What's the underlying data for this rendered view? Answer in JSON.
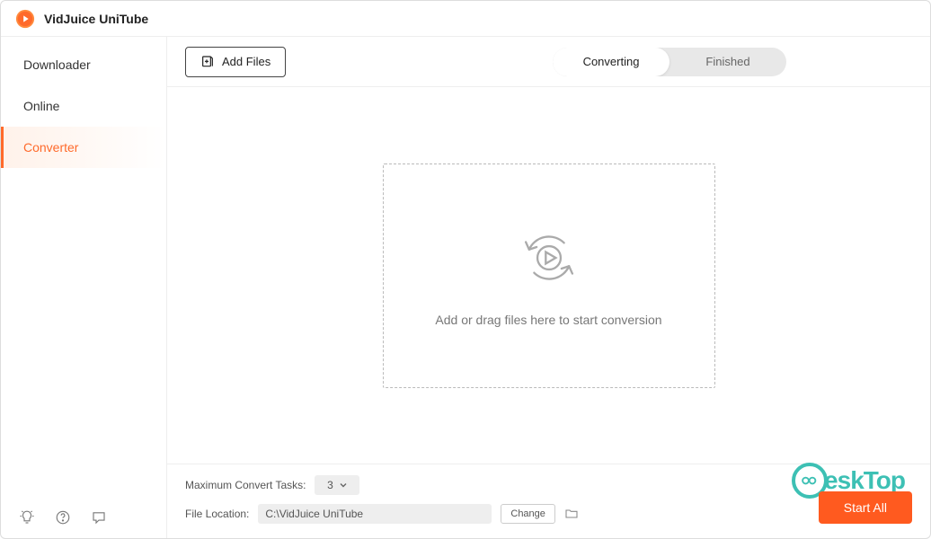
{
  "app": {
    "title": "VidJuice UniTube"
  },
  "sidebar": {
    "items": [
      {
        "label": "Downloader",
        "active": false
      },
      {
        "label": "Online",
        "active": false
      },
      {
        "label": "Converter",
        "active": true
      }
    ]
  },
  "toolbar": {
    "add_files_label": "Add Files",
    "tabs": [
      {
        "label": "Converting",
        "active": true
      },
      {
        "label": "Finished",
        "active": false
      }
    ]
  },
  "dropzone": {
    "hint": "Add or drag files here to start conversion"
  },
  "settings": {
    "max_tasks_label": "Maximum Convert Tasks:",
    "max_tasks_value": "3",
    "file_location_label": "File Location:",
    "file_location_value": "C:\\VidJuice UniTube",
    "change_label": "Change"
  },
  "actions": {
    "start_all_label": "Start All"
  },
  "watermark": {
    "text": "eskTop"
  }
}
